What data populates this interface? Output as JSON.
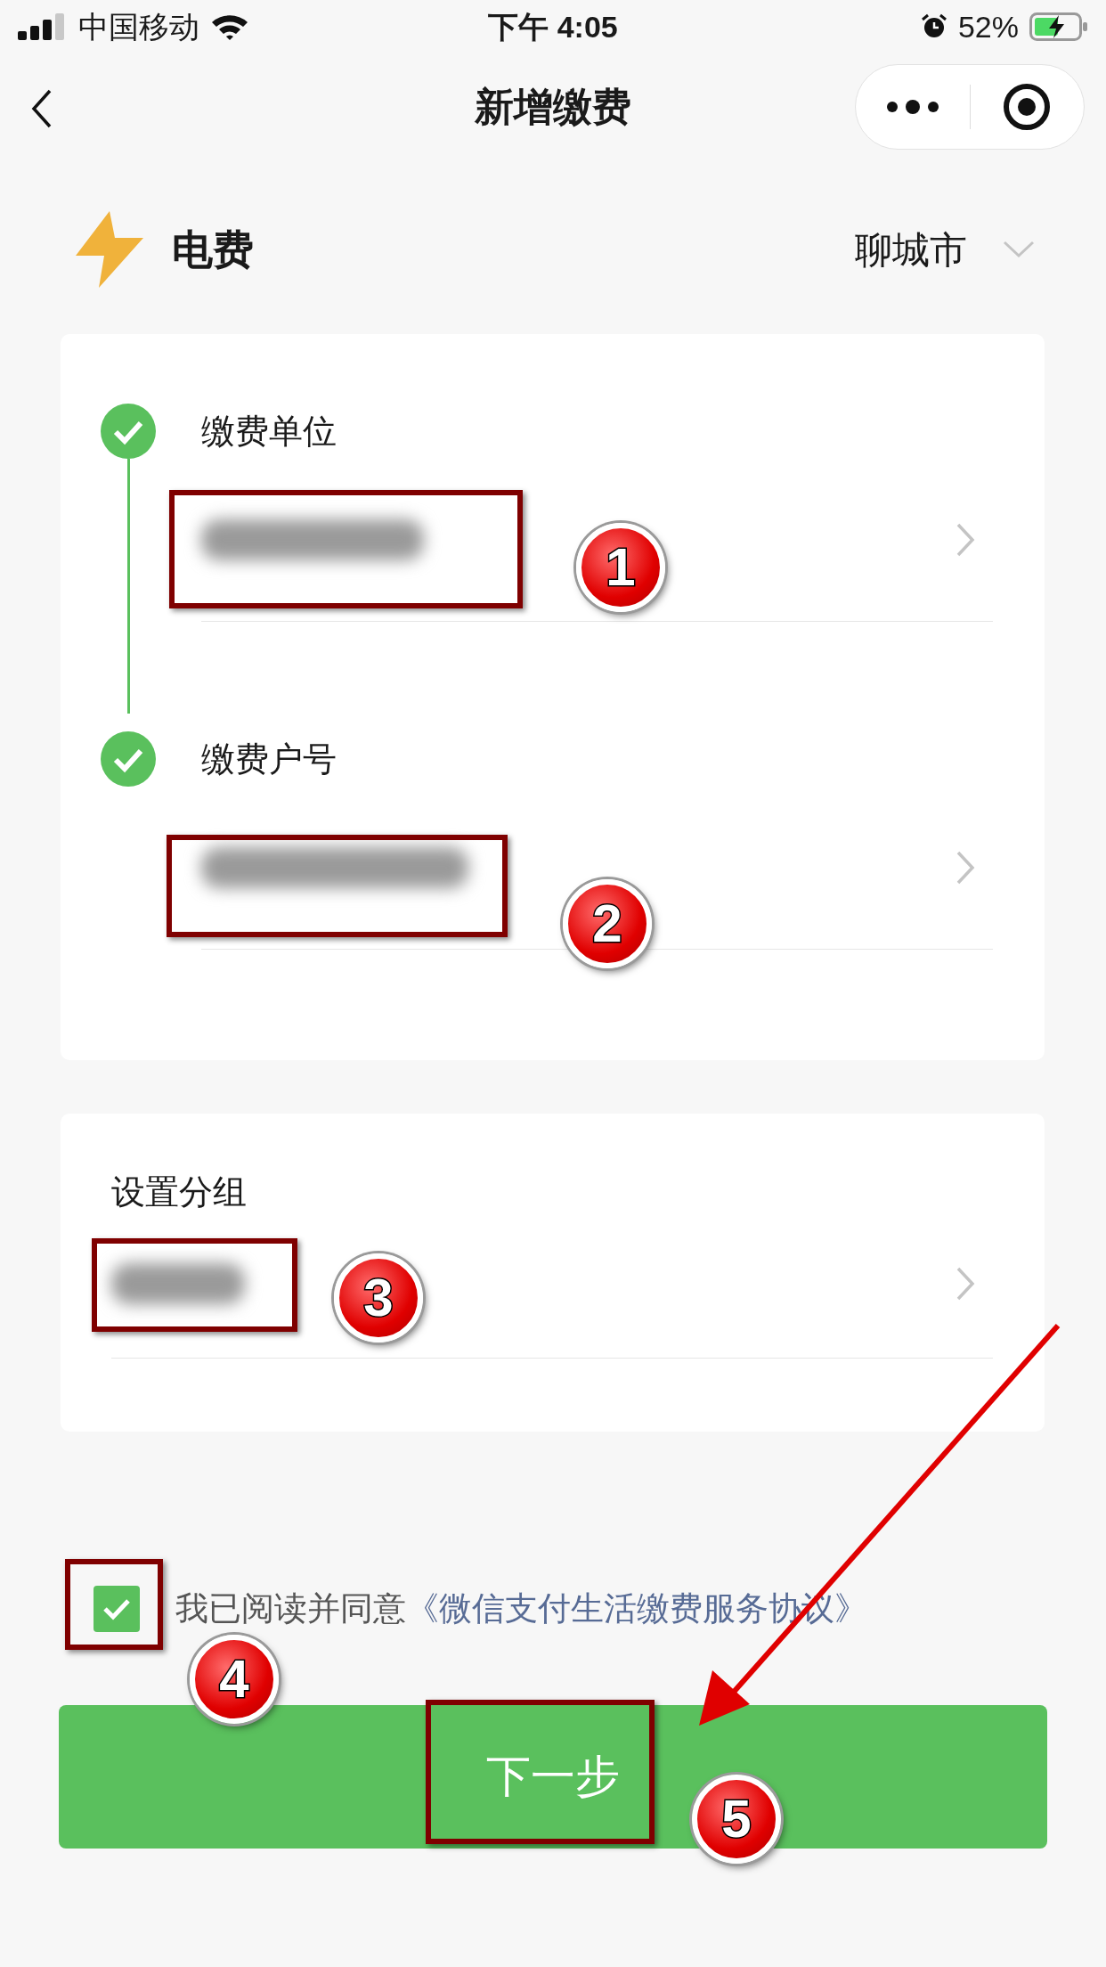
{
  "status_bar": {
    "carrier": "中国移动",
    "time": "下午 4:05",
    "battery": "52%"
  },
  "nav": {
    "title": "新增缴费"
  },
  "header": {
    "category": "电费",
    "city": "聊城市"
  },
  "steps": [
    {
      "label": "缴费单位",
      "done": true,
      "blurred": true
    },
    {
      "label": "缴费户号",
      "done": true,
      "blurred": true
    }
  ],
  "group": {
    "label": "设置分组",
    "blurred": true
  },
  "agreement": {
    "checked": true,
    "text": "我已阅读并同意",
    "link": "《微信支付生活缴费服务协议》"
  },
  "next_button": {
    "label": "下一步"
  },
  "annotations": [
    {
      "label": "1"
    },
    {
      "label": "2"
    },
    {
      "label": "3"
    },
    {
      "label": "4"
    },
    {
      "label": "5"
    }
  ]
}
